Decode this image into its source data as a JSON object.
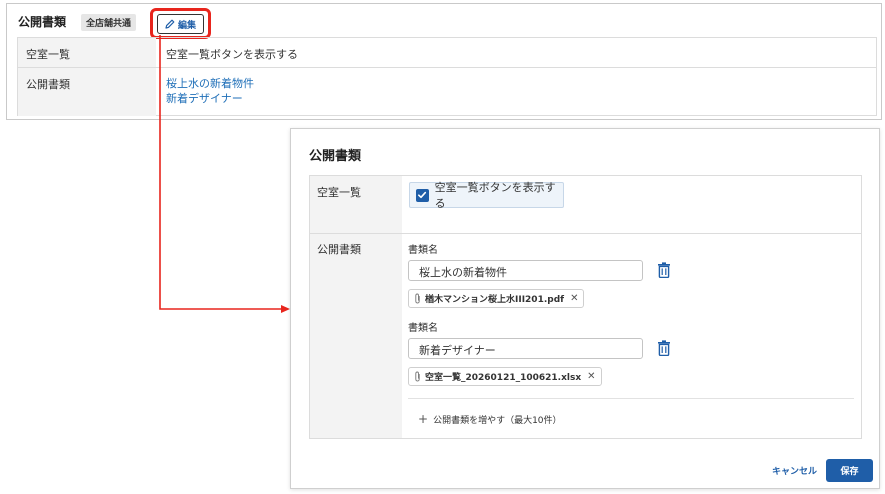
{
  "view": {
    "title": "公開書類",
    "scope_badge": "全店舗共通",
    "edit_label": "編集",
    "rows": [
      {
        "label": "空室一覧",
        "value": "空室一覧ボタンを表示する"
      },
      {
        "label": "公開書類",
        "links": [
          "桜上水の新着物件",
          "新着デザイナー"
        ]
      }
    ]
  },
  "modal": {
    "title": "公開書類",
    "row1_label": "空室一覧",
    "checkbox_label": "空室一覧ボタンを表示する",
    "checkbox_checked": true,
    "row2_label": "公開書類",
    "documents": [
      {
        "field_label": "書類名",
        "name": "桜上水の新着物件",
        "file": "楢木マンション桜上水III201.pdf"
      },
      {
        "field_label": "書類名",
        "name": "新着デザイナー",
        "file": "空室一覧_20260121_100621.xlsx"
      }
    ],
    "add_label": "公開書類を増やす（最大10件）",
    "cancel_label": "キャンセル",
    "save_label": "保存"
  },
  "colors": {
    "accent": "#1f5ea8",
    "link": "#1f6fb8",
    "highlight": "#e8251d"
  },
  "icons": [
    "pencil-icon",
    "checkmark-icon",
    "trash-icon",
    "paperclip-icon",
    "close-icon",
    "plus-icon"
  ]
}
